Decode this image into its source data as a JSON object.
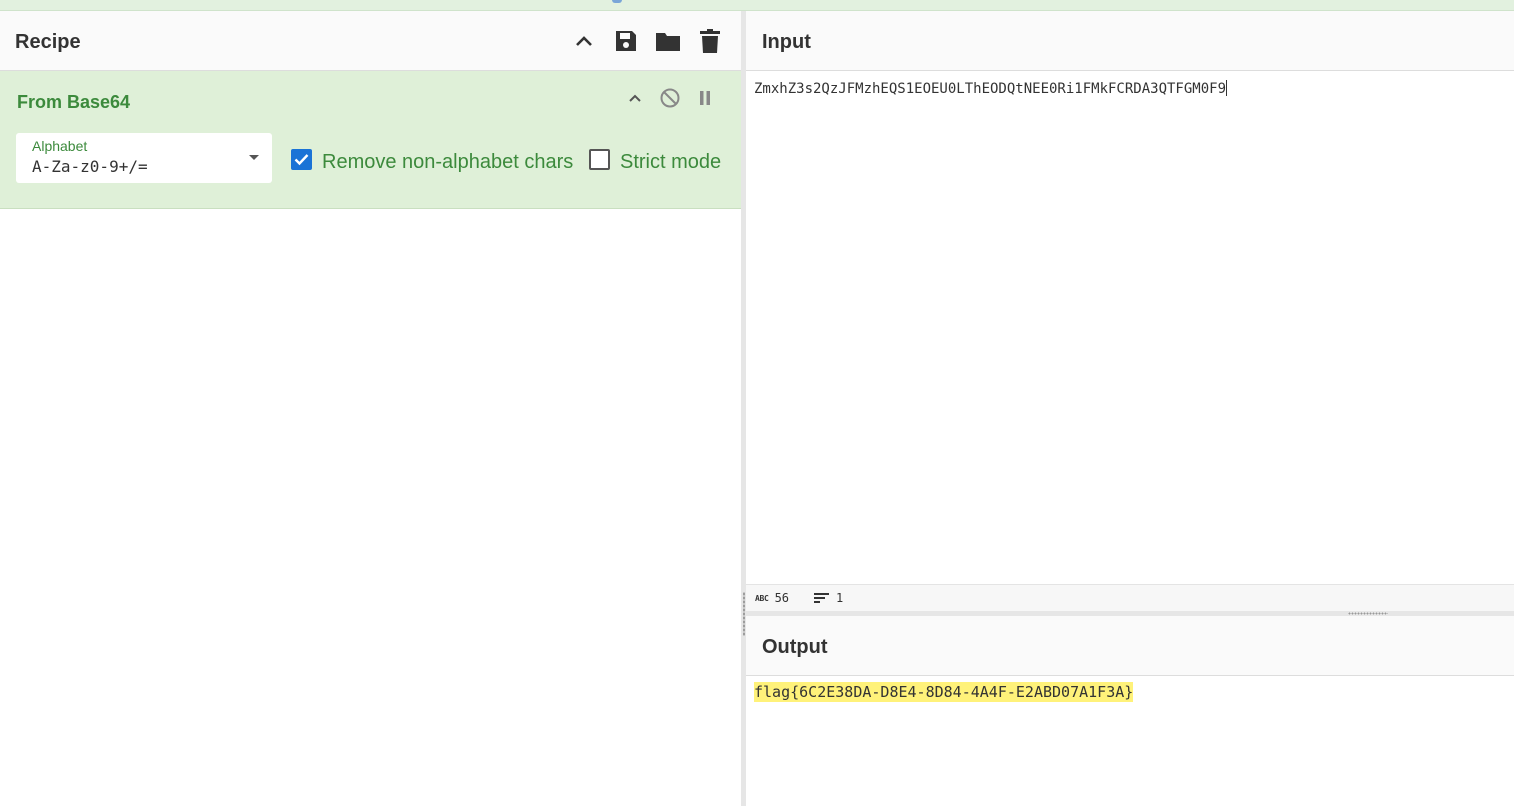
{
  "recipe": {
    "title": "Recipe",
    "icons": [
      "chevron-up-icon",
      "save-icon",
      "folder-icon",
      "trash-icon"
    ]
  },
  "operation": {
    "name": "From Base64",
    "alphabet_label": "Alphabet",
    "alphabet_value": "A-Za-z0-9+/=",
    "remove_nonalpha_label": "Remove non-alphabet chars",
    "remove_nonalpha_checked": true,
    "strict_mode_label": "Strict mode",
    "strict_mode_checked": false
  },
  "input": {
    "title": "Input",
    "text": "ZmxhZ3s2QzJFMzhEQS1EOEU0LThEODQtNEE0Ri1FMkFCRDA3QTFGM0F9",
    "char_count": "56",
    "line_count": "1"
  },
  "output": {
    "title": "Output",
    "text": "flag{6C2E38DA-D8E4-8D84-4A4F-E2ABD07A1F3A}"
  },
  "colors": {
    "operation_bg": "#dff0d8",
    "operation_accent": "#3c8a3c",
    "checkbox_checked": "#1a73d6",
    "highlight": "#fff27a"
  }
}
